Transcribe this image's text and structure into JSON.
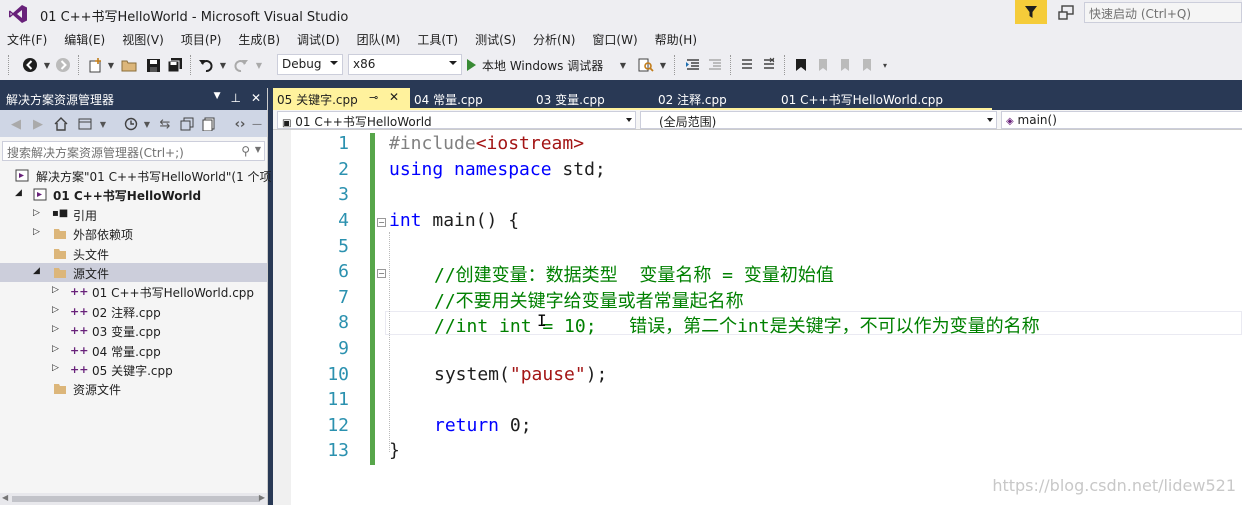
{
  "window": {
    "title": "01 C++书写HelloWorld - Microsoft Visual Studio",
    "quick_launch_placeholder": "快速启动 (Ctrl+Q)"
  },
  "menu": [
    "文件(F)",
    "编辑(E)",
    "视图(V)",
    "项目(P)",
    "生成(B)",
    "调试(D)",
    "团队(M)",
    "工具(T)",
    "测试(S)",
    "分析(N)",
    "窗口(W)",
    "帮助(H)"
  ],
  "toolbar": {
    "config": "Debug",
    "platform": "x86",
    "run_label": "本地 Windows 调试器"
  },
  "solution_explorer": {
    "title": "解决方案资源管理器",
    "search_placeholder": "搜索解决方案资源管理器(Ctrl+;)",
    "items": [
      {
        "label": "解决方案\"01 C++书写HelloWorld\"(1 个项",
        "icon": "solution-icon"
      },
      {
        "label": "01 C++书写HelloWorld",
        "icon": "project-icon"
      },
      {
        "label": "引用",
        "icon": "references-icon"
      },
      {
        "label": "外部依赖项",
        "icon": "folder-icon"
      },
      {
        "label": "头文件",
        "icon": "folder-icon"
      },
      {
        "label": "源文件",
        "icon": "folder-icon"
      },
      {
        "label": "01 C++书写HelloWorld.cpp",
        "icon": "cpp-file-icon"
      },
      {
        "label": "02 注释.cpp",
        "icon": "cpp-file-icon"
      },
      {
        "label": "03 变量.cpp",
        "icon": "cpp-file-icon"
      },
      {
        "label": "04 常量.cpp",
        "icon": "cpp-file-icon"
      },
      {
        "label": "05 关键字.cpp",
        "icon": "cpp-file-icon"
      },
      {
        "label": "资源文件",
        "icon": "folder-icon"
      }
    ]
  },
  "tabs": [
    {
      "label": "05 关键字.cpp",
      "active": true
    },
    {
      "label": "04 常量.cpp",
      "active": false
    },
    {
      "label": "03 变量.cpp",
      "active": false
    },
    {
      "label": "02 注释.cpp",
      "active": false
    },
    {
      "label": "01 C++书写HelloWorld.cpp",
      "active": false
    }
  ],
  "navbar": {
    "project": "01 C++书写HelloWorld",
    "scope": "(全局范围)",
    "member": "main()"
  },
  "editor": {
    "line_numbers": [
      "1",
      "2",
      "3",
      "4",
      "5",
      "6",
      "7",
      "8",
      "9",
      "10",
      "11",
      "12",
      "13"
    ],
    "lines": {
      "l1_pp": "#include",
      "l1_hdr": "<iostream>",
      "l2_kw1": "using",
      "l2_kw2": "namespace",
      "l2_rest": " std;",
      "l4_kw": "int",
      "l4_rest": " main() {",
      "l6": "//创建变量：数据类型  变量名称 = 变量初始值",
      "l7": "//不要用关键字给变量或者常量起名称",
      "l8": "//int int = 10;   错误，第二个int是关键字，不可以作为变量的名称",
      "l10_a": "system(",
      "l10_str": "\"pause\"",
      "l10_b": ");",
      "l12_kw": "return",
      "l12_rest": " 0;",
      "l13": "}"
    }
  },
  "watermark": "https://blog.csdn.net/lidew521",
  "colors": {
    "vs_purple": "#68217a",
    "frame_dark": "#293955",
    "active_tab": "#fff29d",
    "change_bar": "#57a64a",
    "line_number": "#2b91af",
    "keyword": "#0000ff",
    "comment": "#008000",
    "string": "#a31515"
  }
}
